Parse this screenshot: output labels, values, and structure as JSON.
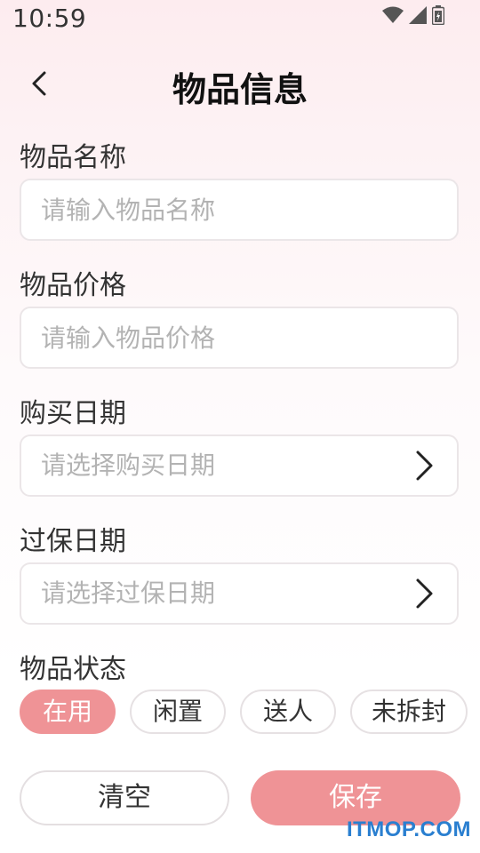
{
  "status_bar": {
    "time": "10:59",
    "icons": [
      "wifi-icon",
      "signal-icon",
      "battery-icon"
    ]
  },
  "header": {
    "title": "物品信息",
    "back_icon": "chevron-left-icon"
  },
  "form": {
    "name": {
      "label": "物品名称",
      "placeholder": "请输入物品名称",
      "value": ""
    },
    "price": {
      "label": "物品价格",
      "placeholder": "请输入物品价格",
      "value": ""
    },
    "purchase_date": {
      "label": "购买日期",
      "placeholder": "请选择购买日期",
      "icon": "chevron-right-icon"
    },
    "warranty_date": {
      "label": "过保日期",
      "placeholder": "请选择过保日期",
      "icon": "chevron-right-icon"
    },
    "item_status": {
      "label": "物品状态",
      "options": [
        "在用",
        "闲置",
        "送人",
        "未拆封"
      ],
      "selected": "在用"
    }
  },
  "actions": {
    "clear_label": "清空",
    "save_label": "保存"
  },
  "watermark": "ITMOP.COM",
  "colors": {
    "accent": "#ef9396",
    "background_top": "#fdecef",
    "border": "#ebe6e8",
    "placeholder": "#b3b3b3"
  }
}
